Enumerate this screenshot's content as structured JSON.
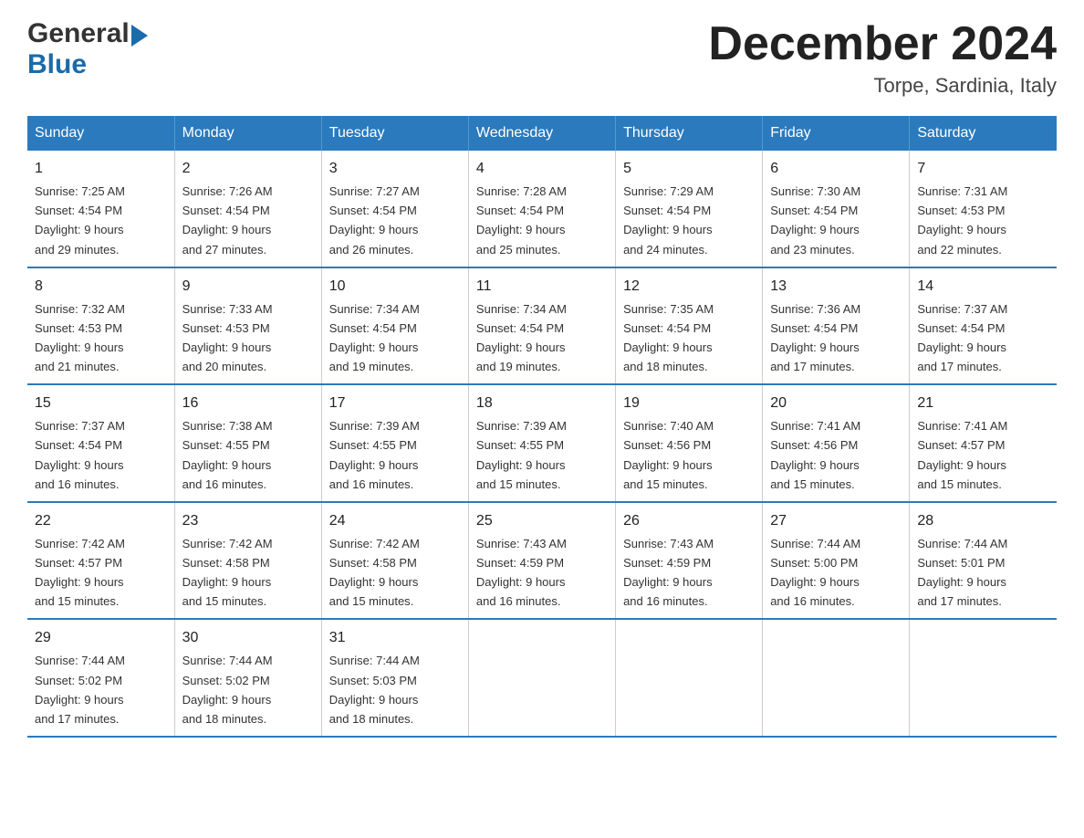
{
  "header": {
    "logo": {
      "general": "General",
      "arrow": "",
      "blue": "Blue"
    },
    "title": "December 2024",
    "location": "Torpe, Sardinia, Italy"
  },
  "weekdays": [
    "Sunday",
    "Monday",
    "Tuesday",
    "Wednesday",
    "Thursday",
    "Friday",
    "Saturday"
  ],
  "weeks": [
    [
      {
        "day": "1",
        "sunrise": "7:25 AM",
        "sunset": "4:54 PM",
        "daylight": "9 hours and 29 minutes."
      },
      {
        "day": "2",
        "sunrise": "7:26 AM",
        "sunset": "4:54 PM",
        "daylight": "9 hours and 27 minutes."
      },
      {
        "day": "3",
        "sunrise": "7:27 AM",
        "sunset": "4:54 PM",
        "daylight": "9 hours and 26 minutes."
      },
      {
        "day": "4",
        "sunrise": "7:28 AM",
        "sunset": "4:54 PM",
        "daylight": "9 hours and 25 minutes."
      },
      {
        "day": "5",
        "sunrise": "7:29 AM",
        "sunset": "4:54 PM",
        "daylight": "9 hours and 24 minutes."
      },
      {
        "day": "6",
        "sunrise": "7:30 AM",
        "sunset": "4:54 PM",
        "daylight": "9 hours and 23 minutes."
      },
      {
        "day": "7",
        "sunrise": "7:31 AM",
        "sunset": "4:53 PM",
        "daylight": "9 hours and 22 minutes."
      }
    ],
    [
      {
        "day": "8",
        "sunrise": "7:32 AM",
        "sunset": "4:53 PM",
        "daylight": "9 hours and 21 minutes."
      },
      {
        "day": "9",
        "sunrise": "7:33 AM",
        "sunset": "4:53 PM",
        "daylight": "9 hours and 20 minutes."
      },
      {
        "day": "10",
        "sunrise": "7:34 AM",
        "sunset": "4:54 PM",
        "daylight": "9 hours and 19 minutes."
      },
      {
        "day": "11",
        "sunrise": "7:34 AM",
        "sunset": "4:54 PM",
        "daylight": "9 hours and 19 minutes."
      },
      {
        "day": "12",
        "sunrise": "7:35 AM",
        "sunset": "4:54 PM",
        "daylight": "9 hours and 18 minutes."
      },
      {
        "day": "13",
        "sunrise": "7:36 AM",
        "sunset": "4:54 PM",
        "daylight": "9 hours and 17 minutes."
      },
      {
        "day": "14",
        "sunrise": "7:37 AM",
        "sunset": "4:54 PM",
        "daylight": "9 hours and 17 minutes."
      }
    ],
    [
      {
        "day": "15",
        "sunrise": "7:37 AM",
        "sunset": "4:54 PM",
        "daylight": "9 hours and 16 minutes."
      },
      {
        "day": "16",
        "sunrise": "7:38 AM",
        "sunset": "4:55 PM",
        "daylight": "9 hours and 16 minutes."
      },
      {
        "day": "17",
        "sunrise": "7:39 AM",
        "sunset": "4:55 PM",
        "daylight": "9 hours and 16 minutes."
      },
      {
        "day": "18",
        "sunrise": "7:39 AM",
        "sunset": "4:55 PM",
        "daylight": "9 hours and 15 minutes."
      },
      {
        "day": "19",
        "sunrise": "7:40 AM",
        "sunset": "4:56 PM",
        "daylight": "9 hours and 15 minutes."
      },
      {
        "day": "20",
        "sunrise": "7:41 AM",
        "sunset": "4:56 PM",
        "daylight": "9 hours and 15 minutes."
      },
      {
        "day": "21",
        "sunrise": "7:41 AM",
        "sunset": "4:57 PM",
        "daylight": "9 hours and 15 minutes."
      }
    ],
    [
      {
        "day": "22",
        "sunrise": "7:42 AM",
        "sunset": "4:57 PM",
        "daylight": "9 hours and 15 minutes."
      },
      {
        "day": "23",
        "sunrise": "7:42 AM",
        "sunset": "4:58 PM",
        "daylight": "9 hours and 15 minutes."
      },
      {
        "day": "24",
        "sunrise": "7:42 AM",
        "sunset": "4:58 PM",
        "daylight": "9 hours and 15 minutes."
      },
      {
        "day": "25",
        "sunrise": "7:43 AM",
        "sunset": "4:59 PM",
        "daylight": "9 hours and 16 minutes."
      },
      {
        "day": "26",
        "sunrise": "7:43 AM",
        "sunset": "4:59 PM",
        "daylight": "9 hours and 16 minutes."
      },
      {
        "day": "27",
        "sunrise": "7:44 AM",
        "sunset": "5:00 PM",
        "daylight": "9 hours and 16 minutes."
      },
      {
        "day": "28",
        "sunrise": "7:44 AM",
        "sunset": "5:01 PM",
        "daylight": "9 hours and 17 minutes."
      }
    ],
    [
      {
        "day": "29",
        "sunrise": "7:44 AM",
        "sunset": "5:02 PM",
        "daylight": "9 hours and 17 minutes."
      },
      {
        "day": "30",
        "sunrise": "7:44 AM",
        "sunset": "5:02 PM",
        "daylight": "9 hours and 18 minutes."
      },
      {
        "day": "31",
        "sunrise": "7:44 AM",
        "sunset": "5:03 PM",
        "daylight": "9 hours and 18 minutes."
      },
      null,
      null,
      null,
      null
    ]
  ],
  "labels": {
    "sunrise": "Sunrise:",
    "sunset": "Sunset:",
    "daylight": "Daylight:"
  }
}
